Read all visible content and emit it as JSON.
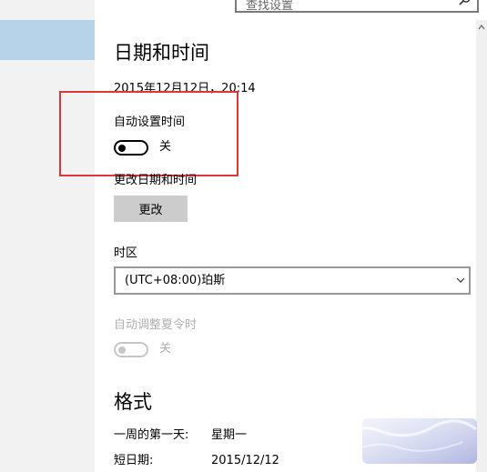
{
  "search": {
    "placeholder": "查找设置"
  },
  "page": {
    "title": "日期和时间",
    "current_datetime": "2015年12月12日，20:14"
  },
  "auto_time": {
    "label": "自动设置时间",
    "state_text": "关"
  },
  "change_datetime": {
    "label": "更改日期和时间",
    "button_label": "更改"
  },
  "timezone": {
    "label": "时区",
    "value": "(UTC+08:00)珀斯"
  },
  "dst": {
    "label": "自动调整夏令时",
    "state_text": "关"
  },
  "format": {
    "title": "格式",
    "rows": [
      {
        "label": "一周的第一天:",
        "value": "星期一"
      },
      {
        "label": "短日期:",
        "value": "2015/12/12"
      }
    ]
  },
  "colors": {
    "nav_selected": "#b6d3ea",
    "highlight": "#e0353b",
    "button_bg": "#cccccc"
  }
}
